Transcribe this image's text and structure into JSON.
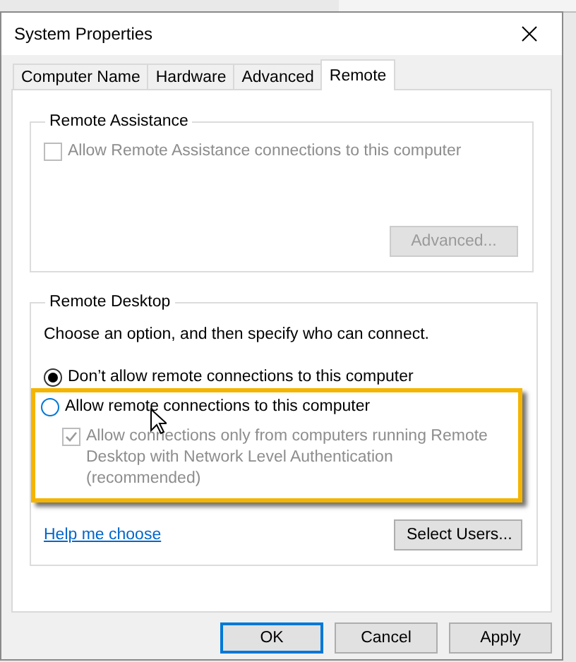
{
  "window": {
    "title": "System Properties"
  },
  "tabs": [
    {
      "label": "Computer Name",
      "selected": false
    },
    {
      "label": "Hardware",
      "selected": false
    },
    {
      "label": "Advanced",
      "selected": false
    },
    {
      "label": "Remote",
      "selected": true
    }
  ],
  "remote_assistance": {
    "title": "Remote Assistance",
    "checkbox": {
      "label": "Allow Remote Assistance connections to this computer",
      "checked": false,
      "disabled": true
    },
    "advanced_button": {
      "label": "Advanced...",
      "disabled": true
    }
  },
  "remote_desktop": {
    "title": "Remote Desktop",
    "instruction": "Choose an option, and then specify who can connect.",
    "options": [
      {
        "label": "Don’t allow remote connections to this computer",
        "selected": true,
        "highlighted": false
      },
      {
        "label": "Allow remote connections to this computer",
        "selected": false,
        "highlighted": true
      }
    ],
    "nla_checkbox": {
      "label": "Allow connections only from computers running Remote Desktop with Network Level Authentication (recommended)",
      "checked": true,
      "disabled": true
    },
    "help_link": "Help me choose",
    "select_users_button": {
      "label": "Select Users...",
      "disabled": false
    }
  },
  "buttons": [
    {
      "label": "OK",
      "default": true
    },
    {
      "label": "Cancel",
      "default": false
    },
    {
      "label": "Apply",
      "default": false
    }
  ]
}
